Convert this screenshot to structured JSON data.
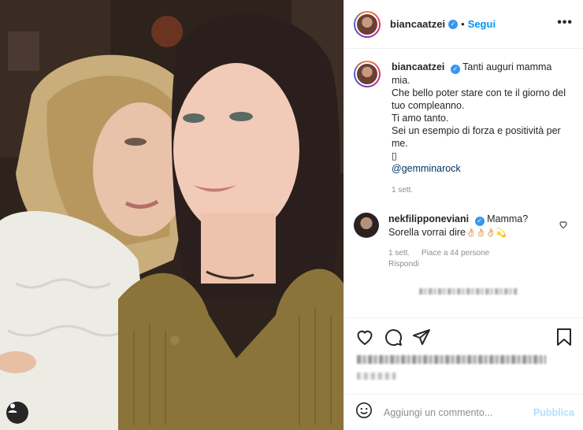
{
  "post": {
    "username": "biancaatzei",
    "dot": "•",
    "follow_label": "Segui",
    "more_label": "•••"
  },
  "caption": {
    "username": "biancaatzei",
    "lines": [
      "Tanti auguri mamma mia.",
      "Che bello poter stare con te il giorno del tuo compleanno.",
      "Ti amo tanto.",
      "Sei un esempio di forza e positività per me.",
      "▯"
    ],
    "mention": "@gemminarock",
    "time": "1 sett."
  },
  "comment": {
    "username": "nekfilipponeviani",
    "text_line1": "Mamma?",
    "text_line2": "Sorella vorrai dire",
    "emojis": "👌🏻👌🏻👌🏻💫",
    "time": "1 sett.",
    "likes": "Piace a 44 persone",
    "reply": "Rispondi"
  },
  "add_comment": {
    "placeholder": "Aggiungi un commento...",
    "publish_label": "Pubblica"
  },
  "icons": {
    "like": "heart-icon",
    "comment": "comment-icon",
    "share": "paper-plane-icon",
    "save": "bookmark-icon",
    "emoji": "smiley-icon",
    "user_tag": "user-icon",
    "verified": "verified-badge-icon"
  },
  "colors": {
    "accent": "#0095f6",
    "verified": "#3897f0",
    "publish_disabled": "#b2dffc",
    "muted": "#8e8e8e",
    "mention": "#00376b"
  }
}
